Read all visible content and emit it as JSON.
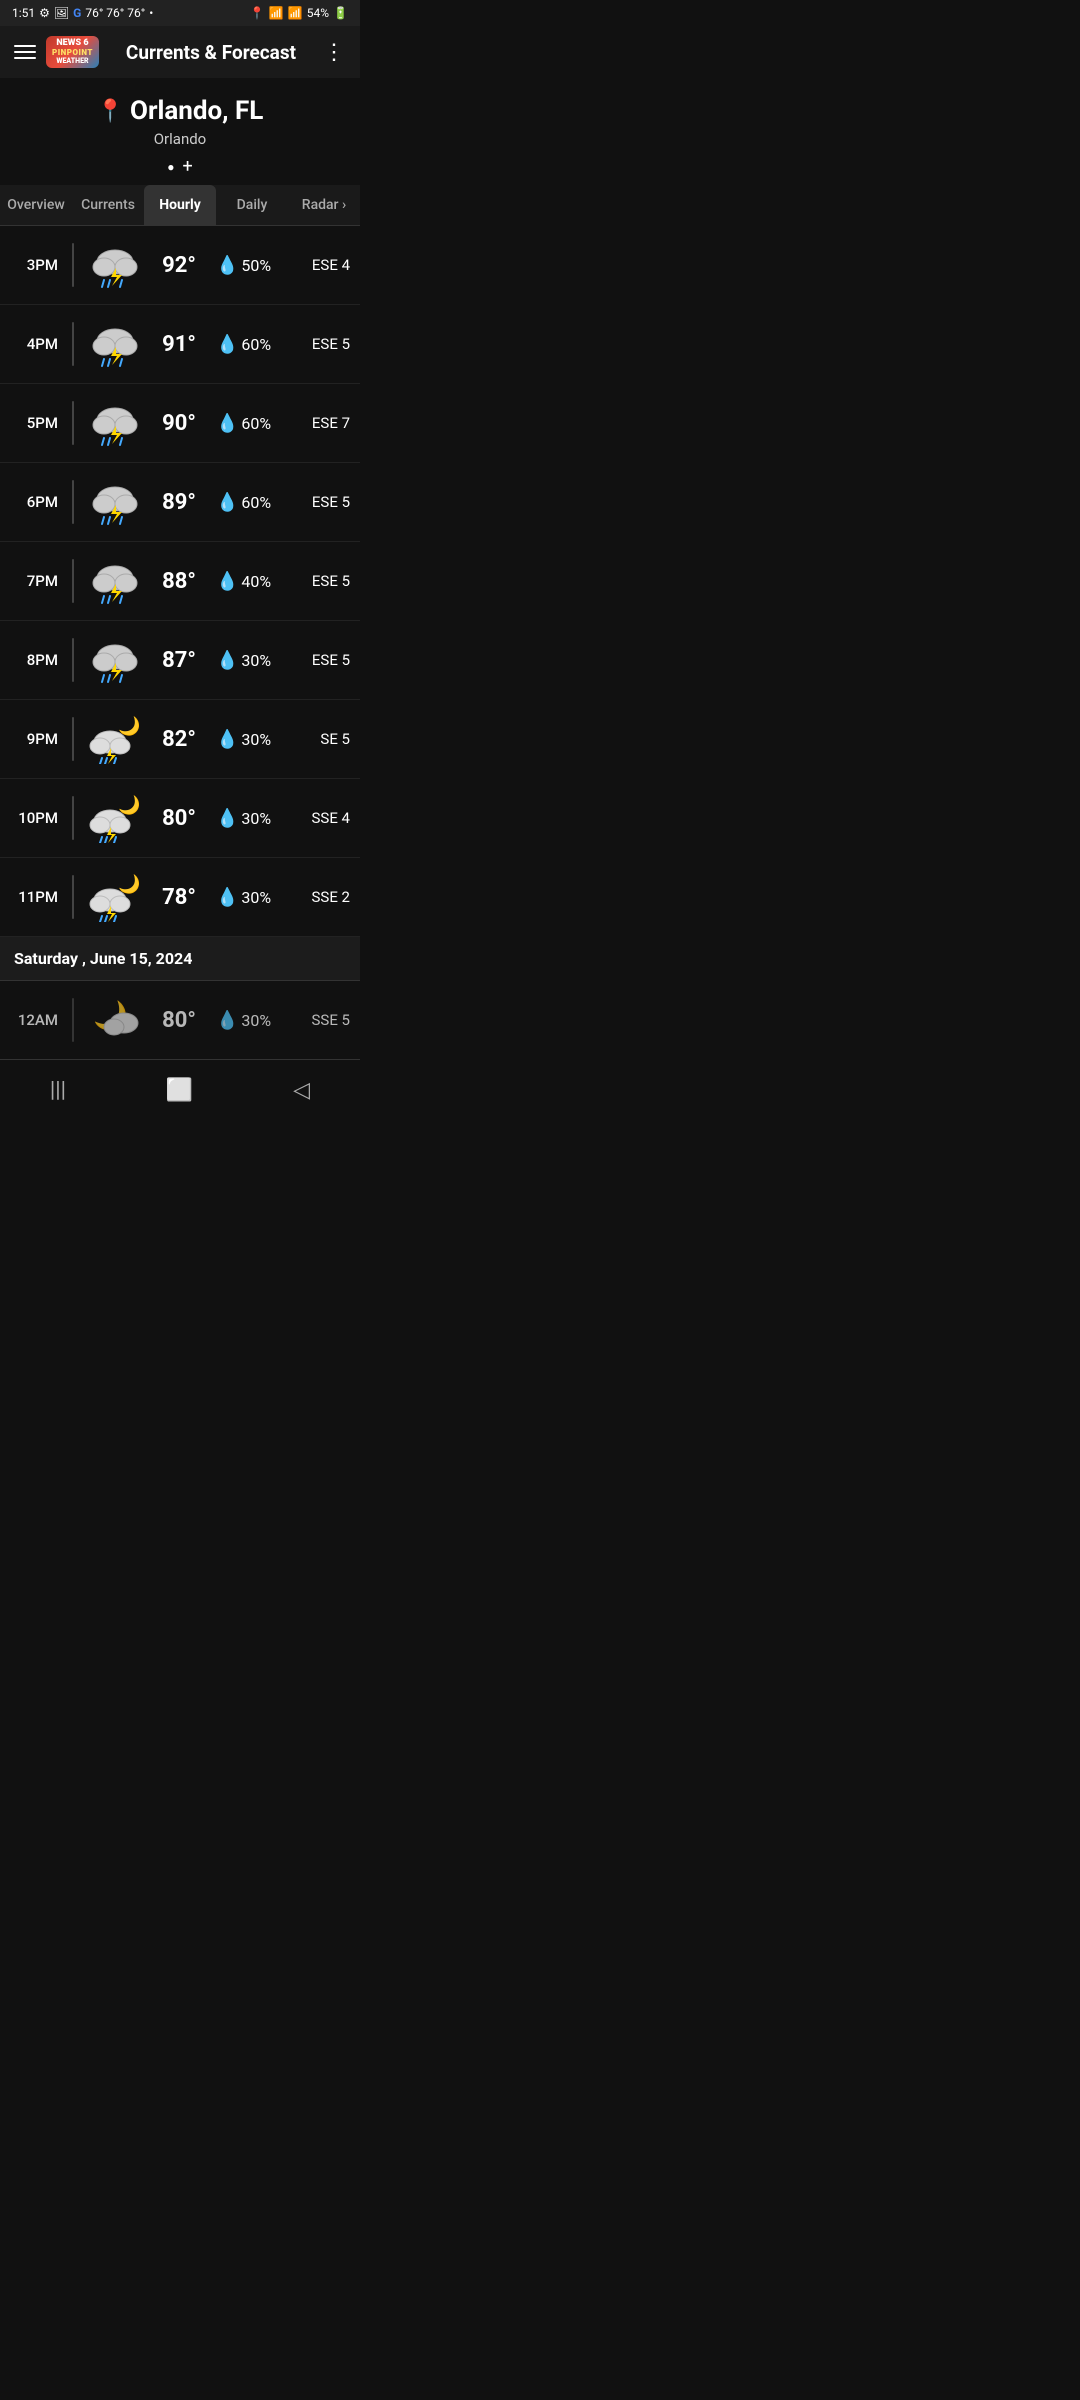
{
  "status_bar": {
    "time": "1:51",
    "temp_readings": "76° 76° 76°",
    "battery": "54%",
    "signal": "●"
  },
  "nav": {
    "title": "Currents & Forecast",
    "logo_news": "NEWS 6",
    "logo_pinpoint": "PINPOINT",
    "logo_weather": "WEATHER"
  },
  "location": {
    "city": "Orlando, FL",
    "sub": "Orlando",
    "pin_icon": "📍",
    "add_icon": "+"
  },
  "tabs": [
    {
      "label": "Overview",
      "active": false
    },
    {
      "label": "Currents",
      "active": false
    },
    {
      "label": "Hourly",
      "active": true
    },
    {
      "label": "Daily",
      "active": false
    },
    {
      "label": "Radar ›",
      "active": false
    }
  ],
  "hourly": [
    {
      "time": "3PM",
      "icon": "⛈",
      "night": false,
      "temp": "92°",
      "precip": "50%",
      "wind": "ESE 4"
    },
    {
      "time": "4PM",
      "icon": "⛈",
      "night": false,
      "temp": "91°",
      "precip": "60%",
      "wind": "ESE 5"
    },
    {
      "time": "5PM",
      "icon": "⛈",
      "night": false,
      "temp": "90°",
      "precip": "60%",
      "wind": "ESE 7"
    },
    {
      "time": "6PM",
      "icon": "⛈",
      "night": false,
      "temp": "89°",
      "precip": "60%",
      "wind": "ESE 5"
    },
    {
      "time": "7PM",
      "icon": "⛈",
      "night": false,
      "temp": "88°",
      "precip": "40%",
      "wind": "ESE 5"
    },
    {
      "time": "8PM",
      "icon": "⛈",
      "night": false,
      "temp": "87°",
      "precip": "30%",
      "wind": "ESE 5"
    },
    {
      "time": "9PM",
      "icon": "🌩",
      "night": true,
      "temp": "82°",
      "precip": "30%",
      "wind": "SE 5"
    },
    {
      "time": "10PM",
      "icon": "🌩",
      "night": true,
      "temp": "80°",
      "precip": "30%",
      "wind": "SSE 4"
    },
    {
      "time": "11PM",
      "icon": "🌩",
      "night": true,
      "temp": "78°",
      "precip": "30%",
      "wind": "SSE 2"
    }
  ],
  "day_separator": "Saturday , June 15, 2024",
  "partial_row": {
    "time": "12AM",
    "icon": "🌤",
    "night": true,
    "temp": "80°",
    "precip": "30%",
    "wind": "SSE 5"
  },
  "bottom_nav": {
    "back": "◁",
    "home": "⬜",
    "recent": "|||"
  }
}
